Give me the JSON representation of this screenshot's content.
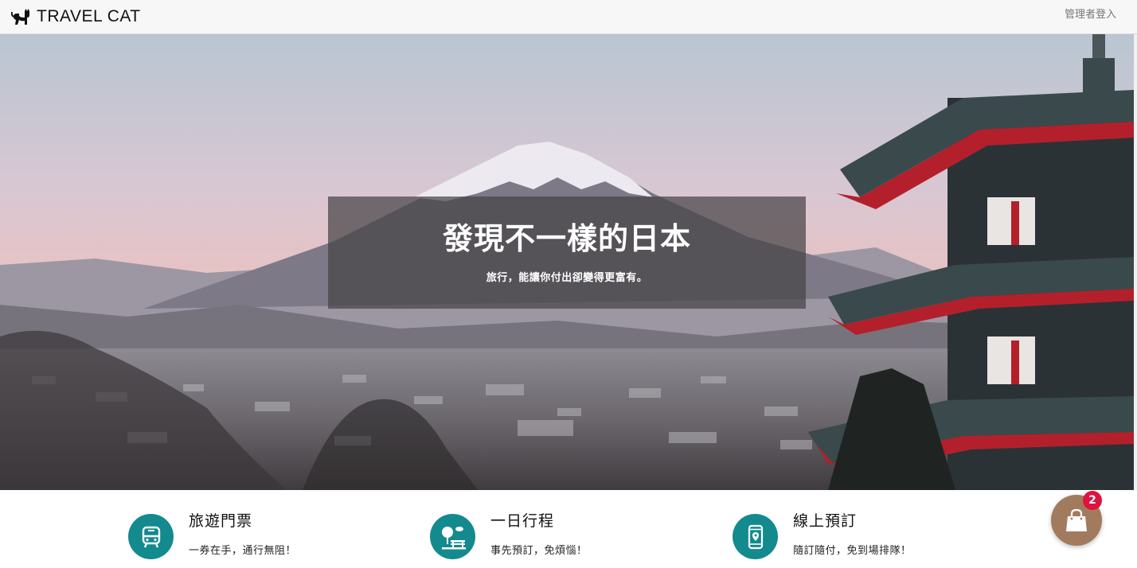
{
  "nav": {
    "brand": "TRAVEL CAT",
    "brand_icon": "cat-icon",
    "admin_login": "管理者登入"
  },
  "hero": {
    "title": "發現不一樣的日本",
    "subtitle": "旅行，能讓你付出卻變得更富有。"
  },
  "features": [
    {
      "icon": "bus-icon",
      "title": "旅遊門票",
      "desc": "一券在手，通行無阻！"
    },
    {
      "icon": "tree-bench-icon",
      "title": "一日行程",
      "desc": "事先預訂，免煩惱！"
    },
    {
      "icon": "mobile-location-icon",
      "title": "線上預訂",
      "desc": "隨訂隨付，免到場排隊！"
    }
  ],
  "cart": {
    "icon": "shopping-bag-icon",
    "count": "2"
  },
  "colors": {
    "accent": "#138a8e",
    "cart": "#a27b5e",
    "badge": "#e0123f"
  }
}
